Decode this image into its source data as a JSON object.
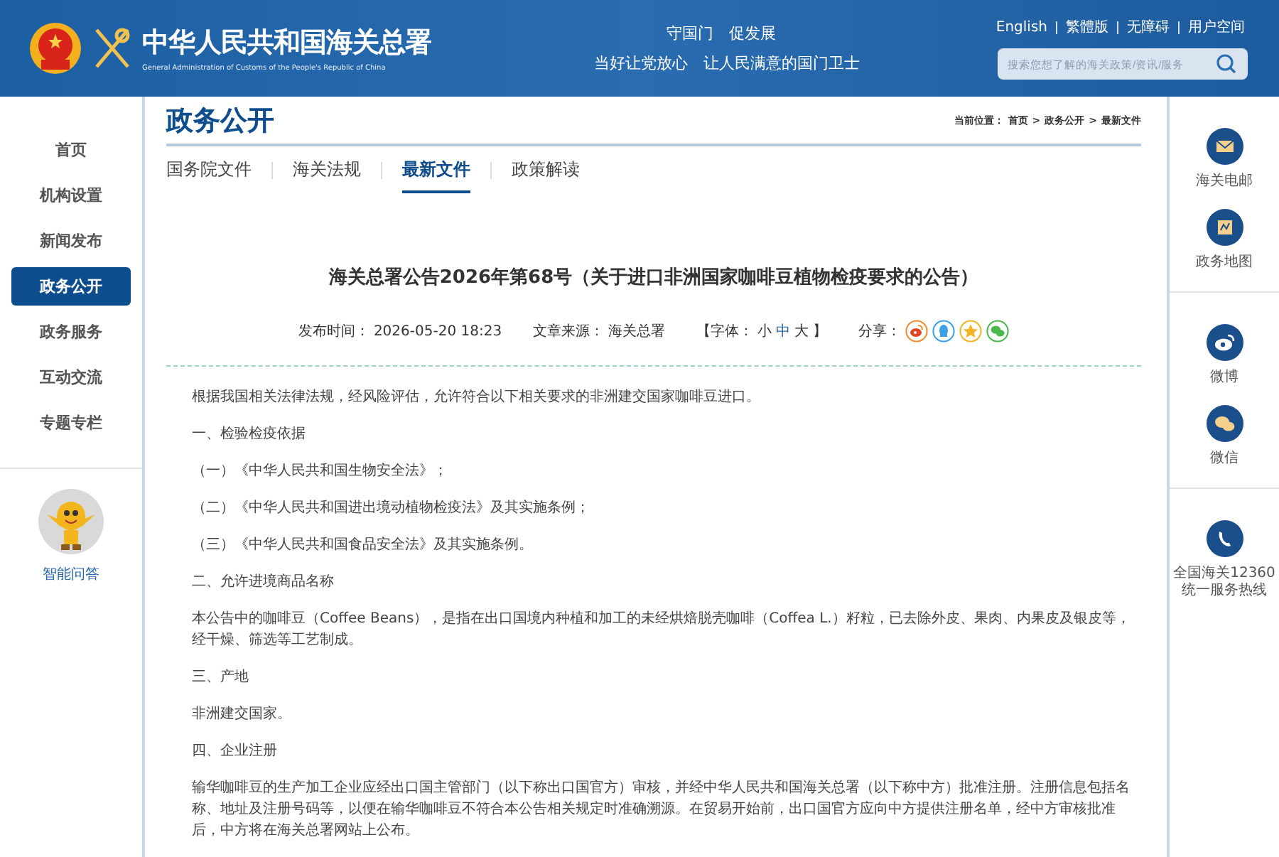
{
  "header": {
    "site_title": "中华人民共和国海关总署",
    "site_subtitle": "General Administration of Customs of the People's Republic of China",
    "slogans": [
      "守国门　促发展",
      "当好让党放心　让人民满意的国门卫士"
    ],
    "links": [
      "English",
      "繁體版",
      "无障碍",
      "用户空间"
    ],
    "search": {
      "placeholder": "搜索您想了解的海关政策/资讯/服务"
    }
  },
  "left_nav": {
    "items": [
      {
        "label": "首页",
        "selected": false
      },
      {
        "label": "机构设置",
        "selected": false
      },
      {
        "label": "新闻发布",
        "selected": false
      },
      {
        "label": "政务公开",
        "selected": true
      },
      {
        "label": "政务服务",
        "selected": false
      },
      {
        "label": "互动交流",
        "selected": false
      },
      {
        "label": "专题专栏",
        "selected": false
      }
    ],
    "assistant": {
      "label": "智能问答"
    }
  },
  "main": {
    "section_title": "政务公开",
    "breadcrumb": {
      "label": "当前位置：",
      "separator": ">",
      "items": [
        "首页",
        "政务公开",
        "最新文件"
      ]
    },
    "tabs": [
      {
        "label": "国务院文件",
        "selected": false
      },
      {
        "label": "海关法规",
        "selected": false
      },
      {
        "label": "最新文件",
        "selected": true
      },
      {
        "label": "政策解读",
        "selected": false
      }
    ],
    "article": {
      "title": "海关总署公告2026年第68号（关于进口非洲国家咖啡豆植物检疫要求的公告）",
      "meta": {
        "date_label": "发布时间：",
        "date": "2026-05-20 18:23",
        "source_label": "文章来源：",
        "source": "海关总署",
        "font_label": "【字体：",
        "font_sizes": [
          {
            "label": "小",
            "selected": false
          },
          {
            "label": "中",
            "selected": true
          },
          {
            "label": "大",
            "selected": false
          }
        ],
        "font_close": "】",
        "share_label": "分享："
      },
      "share": [
        {
          "kind": "weibo"
        },
        {
          "kind": "qq"
        },
        {
          "kind": "star"
        },
        {
          "kind": "wechat"
        }
      ],
      "paragraphs": [
        "根据我国相关法律法规，经风险评估，允许符合以下相关要求的非洲建交国家咖啡豆进口。",
        "一、检验检疫依据",
        "（一）《中华人民共和国生物安全法》；",
        "（二）《中华人民共和国进出境动植物检疫法》及其实施条例；",
        "（三）《中华人民共和国食品安全法》及其实施条例。",
        "二、允许进境商品名称",
        "本公告中的咖啡豆（Coffee Beans），是指在出口国境内种植和加工的未经烘焙脱壳咖啡（Coffea L.）籽粒，已去除外皮、果肉、内果皮及银皮等，经干燥、筛选等工艺制成。",
        "三、产地",
        "非洲建交国家。",
        "四、企业注册",
        "输华咖啡豆的生产加工企业应经出口国主管部门（以下称出口国官方）审核，并经中华人民共和国海关总署（以下称中方）批准注册。注册信息包括名称、地址及注册号码等，以便在输华咖啡豆不符合本公告相关规定时准确溯源。在贸易开始前，出口国官方应向中方提供注册名单，经中方审核批准后，中方将在海关总署网站上公布。"
      ]
    }
  },
  "right_sidebar": {
    "groups": [
      [
        {
          "kind": "mail",
          "lines": [
            "海关电邮"
          ]
        },
        {
          "kind": "map",
          "lines": [
            "政务地图"
          ]
        }
      ],
      [
        {
          "kind": "weibo",
          "lines": [
            "微博"
          ]
        },
        {
          "kind": "wechat",
          "lines": [
            "微信"
          ]
        }
      ],
      [
        {
          "kind": "phone",
          "lines": [
            "全国海关12360",
            "统一服务热线"
          ]
        }
      ]
    ]
  }
}
